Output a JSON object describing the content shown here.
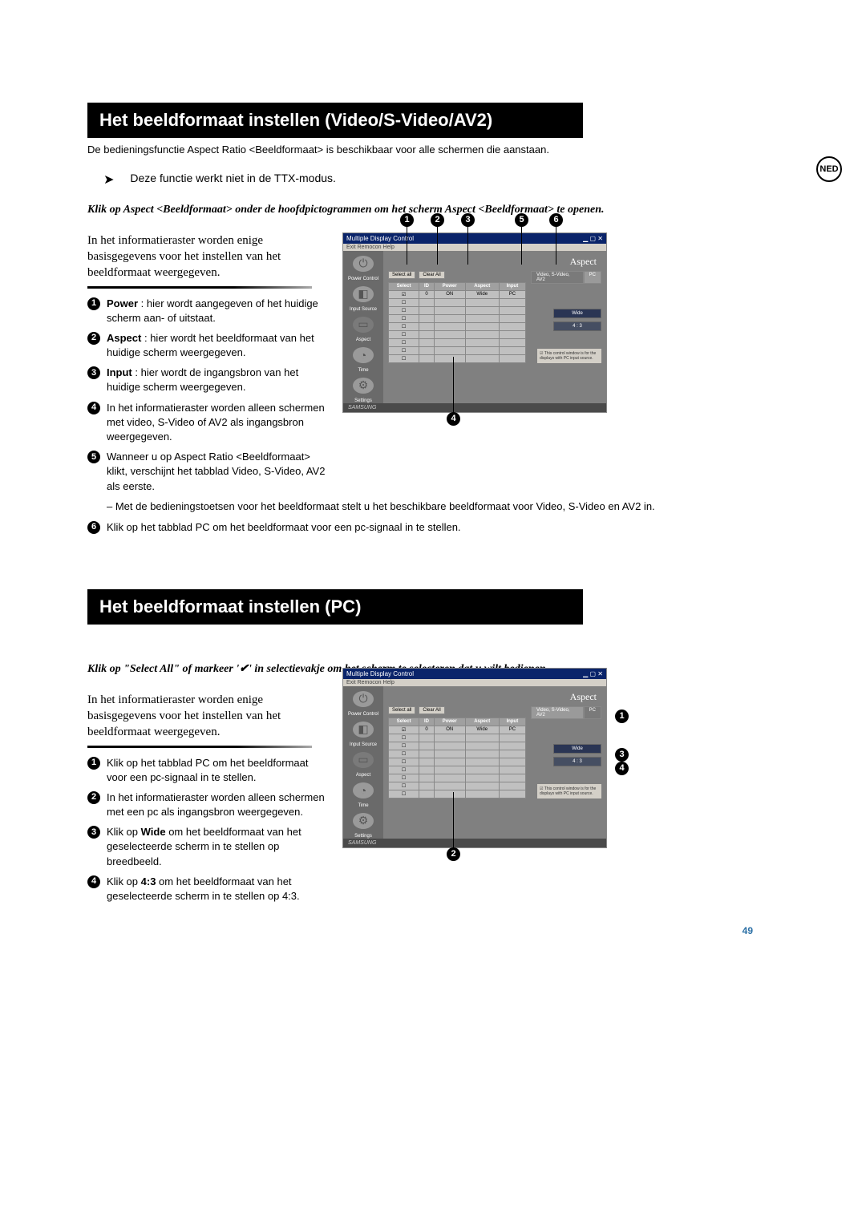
{
  "sideBadge": "NED",
  "pageNumber": "49",
  "section1": {
    "title": "Het beeldformaat instellen (Video/S-Video/AV2)",
    "intro": "De bedieningsfunctie Aspect Ratio <Beeldformaat> is beschikbaar voor alle schermen die aanstaan.",
    "note": "Deze functie werkt niet in de TTX-modus.",
    "boldItalic": "Klik op Aspect <Beeldformaat> onder de hoofdpictogrammen om het scherm Aspect <Beeldformaat> te openen.",
    "serifPara": "In het informatieraster worden enige basisgegevens voor het instellen van het beeldformaat weergegeven.",
    "items": [
      {
        "boldPrefix": "Power",
        "text": " : hier wordt aangegeven of het huidige scherm aan- of uitstaat."
      },
      {
        "boldPrefix": "Aspect",
        "text": " : hier wordt het beeldformaat van het huidige scherm weergegeven."
      },
      {
        "boldPrefix": "Input",
        "text": " : hier wordt de ingangsbron van het huidige scherm weergegeven."
      },
      {
        "boldPrefix": "",
        "text": "In het informatieraster worden alleen schermen met video, S-Video of AV2 als ingangsbron weergegeven."
      },
      {
        "boldPrefix": "",
        "text": "Wanneer u op Aspect Ratio <Beeldformaat> klikt, verschijnt het tabblad Video, S-Video, AV2 als eerste."
      }
    ],
    "subNote": "– Met de bedieningstoetsen voor het beeldformaat stelt u het beschikbare beeldformaat voor Video, S-Video en AV2 in.",
    "item6": "Klik op het tabblad PC om het beeldformaat voor een pc-signaal in te stellen."
  },
  "section2": {
    "title": "Het beeldformaat instellen (PC)",
    "boldItalic": "Klik op \"Select All\" of markeer '✔' in selectievakje om het scherm te selecteren dat u wilt bedienen.",
    "serifPara": "In het informatieraster worden enige basisgegevens voor het instellen van het beeldformaat weergegeven.",
    "items": [
      "Klik op het tabblad PC om het beeldformaat voor een pc-signaal in te stellen.",
      "In het informatieraster worden alleen schermen met een pc als ingangsbron weergegeven.",
      {
        "pre": "Klik op ",
        "bold": "Wide",
        "post": " om het beeldformaat van het geselecteerde scherm in te stellen op breedbeeld."
      },
      {
        "pre": "Klik op ",
        "bold": "4:3",
        "post": " om het beeldformaat van het geselecteerde scherm in te stellen op 4:3."
      }
    ]
  },
  "screenshot": {
    "windowTitle": "Multiple Display Control",
    "winButtons": "▁ ▢ ✕",
    "menu": "Exit   Remocon   Help",
    "panelTitle": "Aspect",
    "btnSelectAll": "Select all",
    "btnClearAll": "Clear All",
    "headers": [
      "Select",
      "ID",
      "Power",
      "Aspect",
      "Input"
    ],
    "row": [
      "☑",
      "0",
      "ON",
      "Wide",
      "PC"
    ],
    "tabs": [
      "Video, S-Video, AV2",
      "PC"
    ],
    "optWide": "Wide",
    "opt43": "4 : 3",
    "disclaimer": "This control window is for the displays with PC input source.",
    "sidebar": [
      "Power Control",
      "Input Source",
      "Aspect",
      "Time",
      "Settings"
    ],
    "logo": "SAMSUNG"
  }
}
